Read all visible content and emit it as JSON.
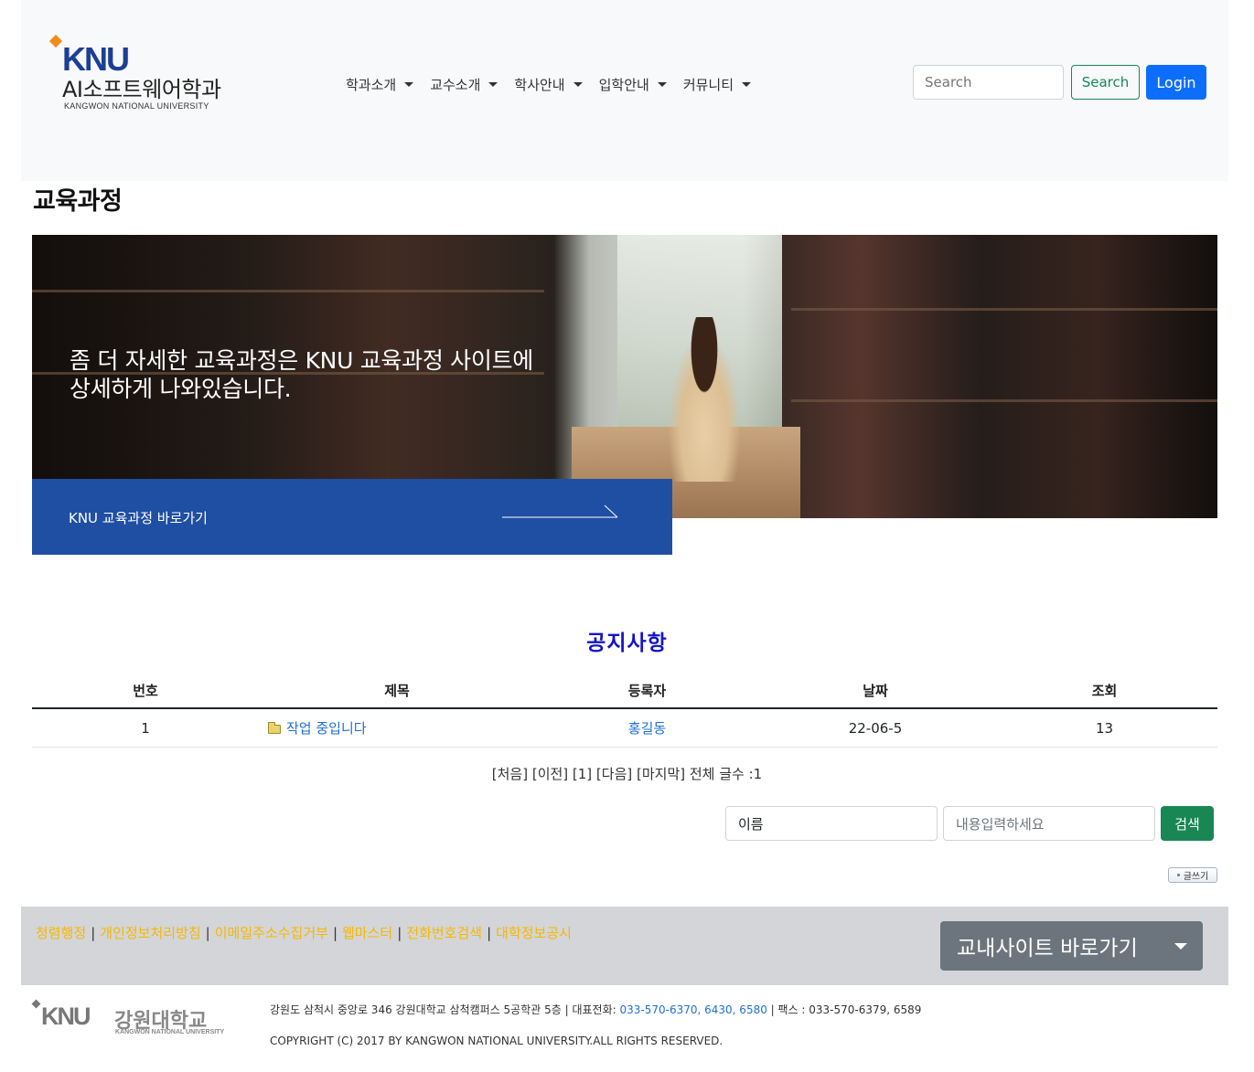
{
  "header": {
    "logo": {
      "knu": "KNU",
      "dept": "AI소프트웨어학과",
      "univ": "KANGWON NATIONAL UNIVERSITY"
    },
    "nav": [
      "학과소개",
      "교수소개",
      "학사안내",
      "입학안내",
      "커뮤니티"
    ],
    "search_placeholder": "Search",
    "search_button": "Search",
    "login_button": "Login"
  },
  "page_title": "교육과정",
  "banner": {
    "line1": "좀 더 자세한 교육과정은 KNU 교육과정 사이트에",
    "line2": "상세하게 나와있습니다.",
    "cta_label": "KNU 교육과정 바로가기"
  },
  "notice": {
    "title": "공지사항",
    "columns": [
      "번호",
      "제목",
      "등록자",
      "날짜",
      "조회"
    ],
    "rows": [
      {
        "no": "1",
        "subject": "작업 중입니다",
        "author": "홍길동",
        "date": "22-06-5",
        "views": "13"
      }
    ],
    "pager": "[처음] [이전] [1] [다음] [마지막] 전체 글수 :1",
    "search_field": "이름",
    "search_placeholder": "내용입력하세요",
    "search_button": "검색",
    "write_button": "글쓰기"
  },
  "footer": {
    "links": [
      "청렴행정",
      "개인정보처리방침",
      "이메일주소수집거부",
      "웹마스터",
      "전화번호검색",
      "대학정보공시"
    ],
    "dropdown": "교내사이트 바로가기",
    "logo": {
      "knu": "KNU",
      "name": "강원대학교",
      "univ": "KANGWON NATIONAL UNIVERSITY"
    },
    "address_prefix": "강원도 삼척시 중앙로 346 강원대학교 삼척캠퍼스 5공학관 5층 | 대표전화: ",
    "phone": "033-570-6370, 6430, 6580",
    "fax": " | 팩스 : 033-570-6379, 6589",
    "copyright": "COPYRIGHT (C) 2017 BY KANGWON NATIONAL UNIVERSITY.ALL RIGHTS RESERVED."
  },
  "colors": {
    "brand_blue": "#1c3f95",
    "cta_blue": "#1f4fa3",
    "notice_title": "#1414c8",
    "footer_link": "#f5b800",
    "success_green": "#198754",
    "primary_blue": "#0d6efd"
  }
}
